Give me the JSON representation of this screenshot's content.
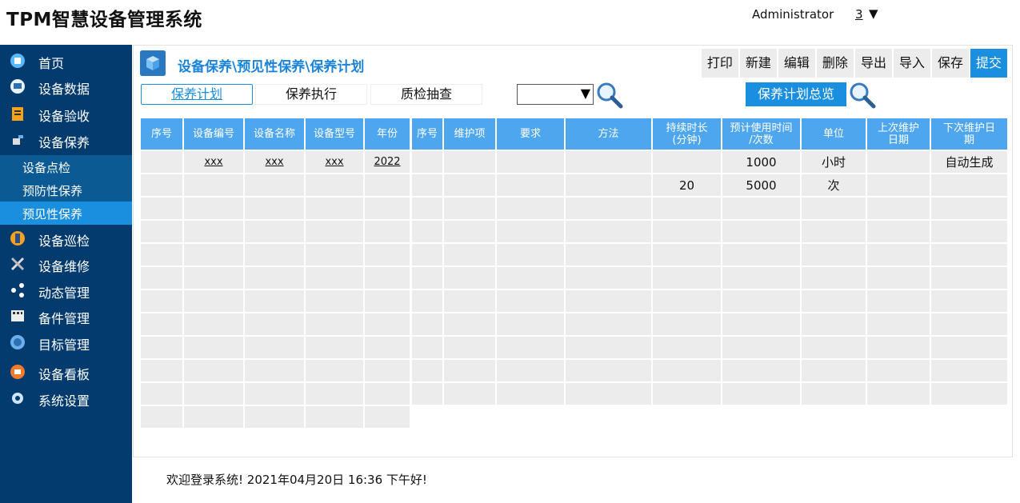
{
  "header": {
    "title": "TPM智慧设备管理系统",
    "user": "Administrator",
    "count": "3",
    "dropdown_arrow": "▼"
  },
  "sidebar": {
    "items": [
      {
        "label": "首页",
        "icon": "home-icon"
      },
      {
        "label": "设备数据",
        "icon": "monitor-icon"
      },
      {
        "label": "设备验收",
        "icon": "clipboard-icon"
      },
      {
        "label": "设备保养",
        "icon": "spray-icon"
      }
    ],
    "subitems": [
      {
        "label": "设备点检"
      },
      {
        "label": "预防性保养"
      },
      {
        "label": "预见性保养"
      }
    ],
    "items2": [
      {
        "label": "设备巡检",
        "icon": "inspection-icon"
      },
      {
        "label": "设备维修",
        "icon": "tools-icon"
      },
      {
        "label": "动态管理",
        "icon": "share-icon"
      },
      {
        "label": "备件管理",
        "icon": "grid-icon"
      },
      {
        "label": "目标管理",
        "icon": "target-icon"
      },
      {
        "label": "设备看板",
        "icon": "dashboard-icon"
      },
      {
        "label": "系统设置",
        "icon": "gear-icon"
      }
    ]
  },
  "breadcrumb": "设备保养\\预见性保养\\保养计划",
  "toolbar": [
    "打印",
    "新建",
    "编辑",
    "删除",
    "导出",
    "导入",
    "保存",
    "提交"
  ],
  "tabs": [
    "保养计划",
    "保养执行",
    "质检抽查"
  ],
  "select": {
    "value": "",
    "arrow": "▼"
  },
  "overview_button": "保养计划总览",
  "left_table": {
    "headers": [
      "序号",
      "设备编号",
      "设备名称",
      "设备型号",
      "年份"
    ],
    "rows": [
      [
        "",
        "xxx",
        "xxx",
        "xxx",
        "2022"
      ]
    ]
  },
  "right_table": {
    "headers": [
      "序号",
      "维护项",
      "要求",
      "方法",
      "持续时长\n(分钟)",
      "预计使用时间\n/次数",
      "单位",
      "上次维护\n日期",
      "下次维护日\n期"
    ],
    "rows": [
      [
        "",
        "",
        "",
        "",
        "",
        "1000",
        "小时",
        "",
        "自动生成"
      ],
      [
        "",
        "",
        "",
        "",
        "20",
        "5000",
        "次",
        "",
        ""
      ]
    ]
  },
  "footer": {
    "welcome": "欢迎登录系统!  2021年04月20日 16:36 下午好!"
  },
  "colors": {
    "sidebar_bg": "#033b6e",
    "accent": "#1a8fe0",
    "header_cell": "#4ea6ee"
  }
}
